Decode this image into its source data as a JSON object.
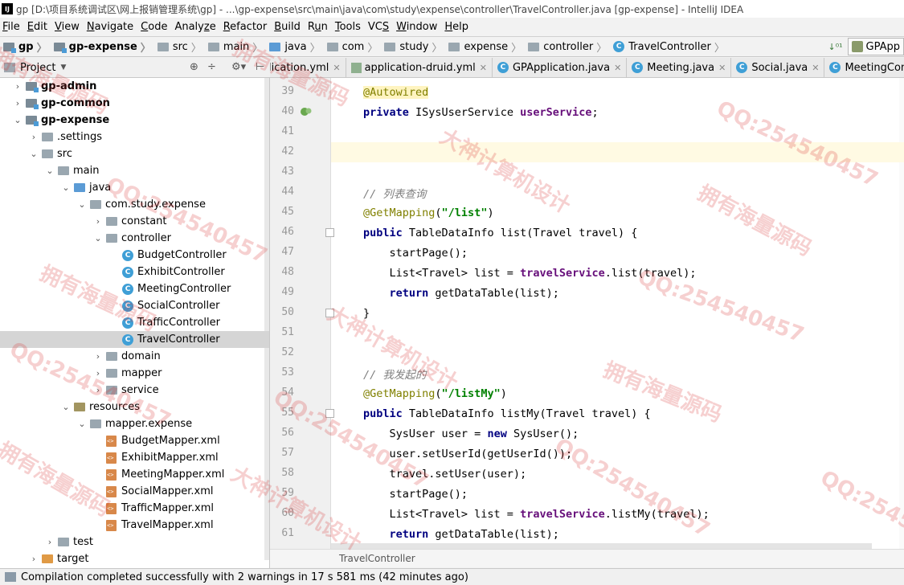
{
  "window": {
    "title": "gp [D:\\项目系统调试区\\网上报销管理系统\\gp] - ...\\gp-expense\\src\\main\\java\\com\\study\\expense\\controller\\TravelController.java [gp-expense] - IntelliJ IDEA",
    "logo": "IJ"
  },
  "menu": [
    {
      "mn": "F",
      "rest": "ile"
    },
    {
      "mn": "E",
      "rest": "dit"
    },
    {
      "mn": "V",
      "rest": "iew"
    },
    {
      "mn": "N",
      "rest": "avigate"
    },
    {
      "mn": "C",
      "rest": "ode"
    },
    {
      "pre": "Analy",
      "mn": "z",
      "rest": "e"
    },
    {
      "mn": "R",
      "rest": "efactor"
    },
    {
      "mn": "B",
      "rest": "uild"
    },
    {
      "pre": "R",
      "mn": "u",
      "rest": "n"
    },
    {
      "mn": "T",
      "rest": "ools"
    },
    {
      "pre": "VC",
      "mn": "S",
      "rest": ""
    },
    {
      "mn": "W",
      "rest": "indow"
    },
    {
      "mn": "H",
      "rest": "elp"
    }
  ],
  "breadcrumb": [
    "gp",
    "gp-expense",
    "src",
    "main",
    "java",
    "com",
    "study",
    "expense",
    "controller",
    "TravelController"
  ],
  "nav_right": {
    "sort_label": "↓⁰¹",
    "run_config": "GPApp"
  },
  "project_panel": {
    "label": "Project",
    "dropdown": "▼",
    "tool1": "⊕",
    "tool2": "÷",
    "tool3": "⚙▾",
    "tool4": "⊢"
  },
  "tabs": [
    {
      "label": "lication.yml"
    },
    {
      "label": "application-druid.yml"
    },
    {
      "label": "GPApplication.java"
    },
    {
      "label": "Meeting.java"
    },
    {
      "label": "Social.java"
    },
    {
      "label": "MeetingController.ja"
    }
  ],
  "tree": [
    {
      "label": "gp-admin",
      "arrow": "›",
      "indent": 0,
      "icon": "module",
      "bold": true
    },
    {
      "label": "gp-common",
      "arrow": "›",
      "indent": 0,
      "icon": "module",
      "bold": true
    },
    {
      "label": "gp-expense",
      "arrow": "⌄",
      "indent": 0,
      "icon": "module",
      "bold": true
    },
    {
      "label": ".settings",
      "arrow": "›",
      "indent": 1,
      "icon": "folder"
    },
    {
      "label": "src",
      "arrow": "⌄",
      "indent": 1,
      "icon": "folder"
    },
    {
      "label": "main",
      "arrow": "⌄",
      "indent": 2,
      "icon": "folder"
    },
    {
      "label": "java",
      "arrow": "⌄",
      "indent": 3,
      "icon": "src"
    },
    {
      "label": "com.study.expense",
      "arrow": "⌄",
      "indent": 4,
      "icon": "folder"
    },
    {
      "label": "constant",
      "arrow": "›",
      "indent": 5,
      "icon": "folder"
    },
    {
      "label": "controller",
      "arrow": "⌄",
      "indent": 5,
      "icon": "folder"
    },
    {
      "label": "BudgetController",
      "arrow": "",
      "indent": 6,
      "icon": "class"
    },
    {
      "label": "ExhibitController",
      "arrow": "",
      "indent": 6,
      "icon": "class"
    },
    {
      "label": "MeetingController",
      "arrow": "",
      "indent": 6,
      "icon": "class"
    },
    {
      "label": "SocialController",
      "arrow": "",
      "indent": 6,
      "icon": "class"
    },
    {
      "label": "TrafficController",
      "arrow": "",
      "indent": 6,
      "icon": "class"
    },
    {
      "label": "TravelController",
      "arrow": "",
      "indent": 6,
      "icon": "class",
      "selected": true
    },
    {
      "label": "domain",
      "arrow": "›",
      "indent": 5,
      "icon": "folder"
    },
    {
      "label": "mapper",
      "arrow": "›",
      "indent": 5,
      "icon": "folder"
    },
    {
      "label": "service",
      "arrow": "›",
      "indent": 5,
      "icon": "folder"
    },
    {
      "label": "resources",
      "arrow": "⌄",
      "indent": 3,
      "icon": "res"
    },
    {
      "label": "mapper.expense",
      "arrow": "⌄",
      "indent": 4,
      "icon": "folder"
    },
    {
      "label": "BudgetMapper.xml",
      "arrow": "",
      "indent": 5,
      "icon": "xml"
    },
    {
      "label": "ExhibitMapper.xml",
      "arrow": "",
      "indent": 5,
      "icon": "xml"
    },
    {
      "label": "MeetingMapper.xml",
      "arrow": "",
      "indent": 5,
      "icon": "xml"
    },
    {
      "label": "SocialMapper.xml",
      "arrow": "",
      "indent": 5,
      "icon": "xml"
    },
    {
      "label": "TrafficMapper.xml",
      "arrow": "",
      "indent": 5,
      "icon": "xml"
    },
    {
      "label": "TravelMapper.xml",
      "arrow": "",
      "indent": 5,
      "icon": "xml"
    },
    {
      "label": "test",
      "arrow": "›",
      "indent": 2,
      "icon": "folder"
    },
    {
      "label": "target",
      "arrow": "›",
      "indent": 1,
      "icon": "target"
    }
  ],
  "editor": {
    "class_icon": "C",
    "fold_lines": [
      46,
      50,
      55
    ],
    "bean_line": 40,
    "current_line": 42,
    "lines": [
      {
        "n": "39",
        "tokens": [
          [
            "annot hl",
            "@Autowired"
          ]
        ]
      },
      {
        "n": "40",
        "tokens": [
          [
            "kw",
            "private"
          ],
          [
            "ident",
            " ISysUserService "
          ],
          [
            "field",
            "userService"
          ],
          [
            "ident",
            ";"
          ]
        ]
      },
      {
        "n": "41",
        "tokens": []
      },
      {
        "n": "42",
        "tokens": []
      },
      {
        "n": "43",
        "tokens": []
      },
      {
        "n": "44",
        "tokens": [
          [
            "cmt",
            "// 列表查询"
          ]
        ]
      },
      {
        "n": "45",
        "tokens": [
          [
            "annot",
            "@GetMapping"
          ],
          [
            "ident",
            "("
          ],
          [
            "str",
            "\"/list\""
          ],
          [
            "ident",
            ")"
          ]
        ]
      },
      {
        "n": "46",
        "tokens": [
          [
            "kw",
            "public"
          ],
          [
            "ident",
            " TableDataInfo list(Travel travel) {"
          ]
        ]
      },
      {
        "n": "47",
        "tokens": [
          [
            "ident",
            "    startPage();"
          ]
        ]
      },
      {
        "n": "48",
        "tokens": [
          [
            "ident",
            "    List<Travel> list = "
          ],
          [
            "field",
            "travelService"
          ],
          [
            "ident",
            ".list(travel);"
          ]
        ]
      },
      {
        "n": "49",
        "tokens": [
          [
            "ident",
            "    "
          ],
          [
            "kw",
            "return"
          ],
          [
            "ident",
            " getDataTable(list);"
          ]
        ]
      },
      {
        "n": "50",
        "tokens": [
          [
            "ident",
            "}"
          ]
        ]
      },
      {
        "n": "51",
        "tokens": []
      },
      {
        "n": "52",
        "tokens": []
      },
      {
        "n": "53",
        "tokens": [
          [
            "cmt",
            "// 我发起的"
          ]
        ]
      },
      {
        "n": "54",
        "tokens": [
          [
            "annot",
            "@GetMapping"
          ],
          [
            "ident",
            "("
          ],
          [
            "str",
            "\"/listMy\""
          ],
          [
            "ident",
            ")"
          ]
        ]
      },
      {
        "n": "55",
        "tokens": [
          [
            "kw",
            "public"
          ],
          [
            "ident",
            " TableDataInfo listMy(Travel travel) {"
          ]
        ]
      },
      {
        "n": "56",
        "tokens": [
          [
            "ident",
            "    SysUser user = "
          ],
          [
            "kw",
            "new"
          ],
          [
            "ident",
            " SysUser();"
          ]
        ]
      },
      {
        "n": "57",
        "tokens": [
          [
            "ident",
            "    user.setUserId(getUserId());"
          ]
        ]
      },
      {
        "n": "58",
        "tokens": [
          [
            "ident",
            "    travel.setUser(user);"
          ]
        ]
      },
      {
        "n": "59",
        "tokens": [
          [
            "ident",
            "    startPage();"
          ]
        ]
      },
      {
        "n": "60",
        "tokens": [
          [
            "ident",
            "    List<Travel> list = "
          ],
          [
            "field",
            "travelService"
          ],
          [
            "ident",
            ".listMy(travel);"
          ]
        ]
      },
      {
        "n": "61",
        "tokens": [
          [
            "ident",
            "    "
          ],
          [
            "kw",
            "return"
          ],
          [
            "ident",
            " getDataTable(list);"
          ]
        ]
      }
    ],
    "crumb": "TravelController"
  },
  "status": {
    "text": "Compilation completed successfully with 2 warnings in 17 s 581 ms (42 minutes ago)"
  },
  "watermarks": [
    {
      "text": "QQ:254540457"
    },
    {
      "text": "大神计算机设计"
    },
    {
      "text": "拥有海量源码"
    }
  ]
}
